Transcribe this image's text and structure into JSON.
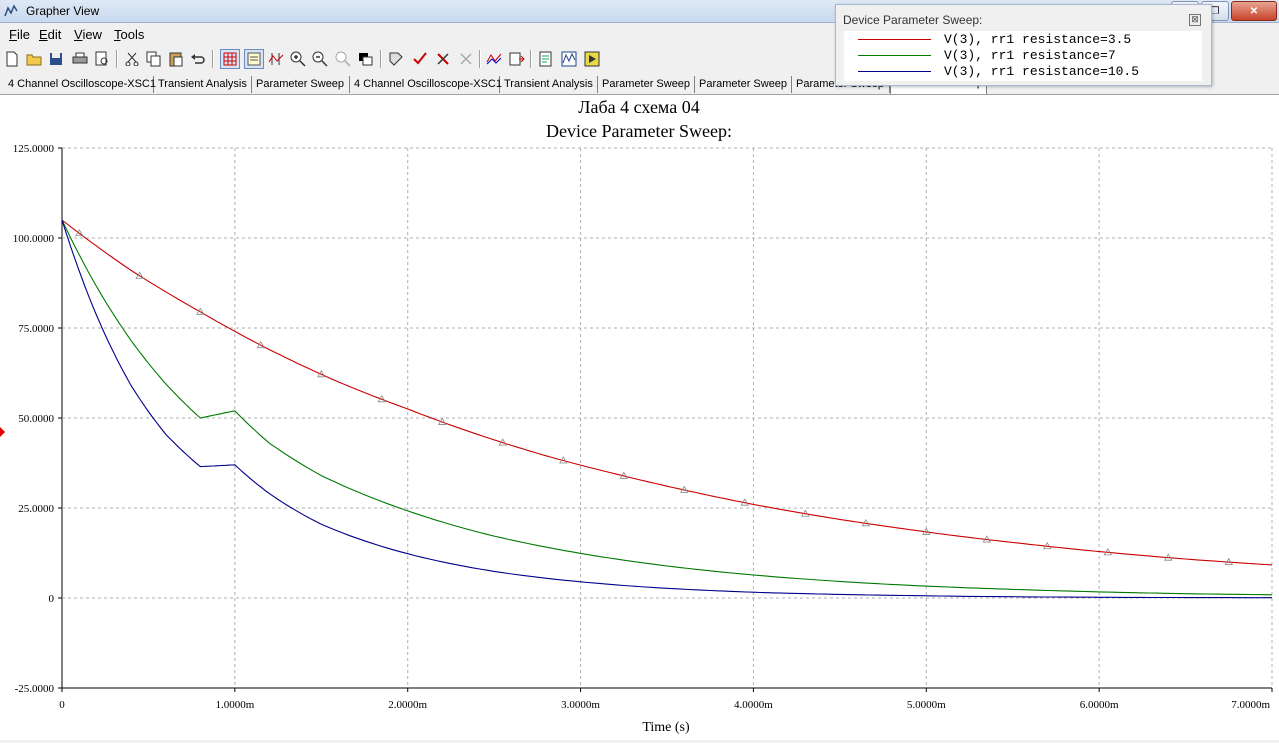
{
  "window": {
    "title": "Grapher View"
  },
  "menu": [
    {
      "label": "File",
      "accel": "F"
    },
    {
      "label": "Edit",
      "accel": "E"
    },
    {
      "label": "View",
      "accel": "V"
    },
    {
      "label": "Tools",
      "accel": "T"
    }
  ],
  "tabs": [
    "4 Channel Oscilloscope-XSC1",
    "Transient Analysis",
    "Parameter Sweep",
    "4 Channel Oscilloscope-XSC1",
    "Transient Analysis",
    "Parameter Sweep",
    "Parameter Sweep",
    "Parameter Sweep",
    "Parameter Sweep"
  ],
  "selected_tab": 8,
  "legend": {
    "title": "Device Parameter Sweep:",
    "items": [
      {
        "label": "V(3), rr1 resistance=3.5",
        "color": "#cc0000"
      },
      {
        "label": "V(3), rr1 resistance=7",
        "color": "#007a00"
      },
      {
        "label": "V(3), rr1 resistance=10.5",
        "color": "#00008b"
      }
    ]
  },
  "chart_data": {
    "type": "line",
    "title": "Лаба 4 схема 04",
    "subtitle": "Device Parameter Sweep:",
    "xlabel": "Time (s)",
    "ylabel": "",
    "xlim": [
      0,
      0.007
    ],
    "ylim": [
      -25,
      125
    ],
    "x_ticks": [
      "0",
      "1.0000m",
      "2.0000m",
      "3.0000m",
      "4.0000m",
      "5.0000m",
      "6.0000m",
      "7.0000m"
    ],
    "y_ticks": [
      "125.0000",
      "100.0000",
      "75.0000",
      "50.0000",
      "25.0000",
      "0",
      "-25.0000"
    ],
    "grid": true,
    "series": [
      {
        "name": "V(3), rr1 resistance=3.5",
        "color": "#cc0000",
        "marker": "triangle",
        "x": [
          0,
          0.0004,
          0.0008,
          0.0012,
          0.0016,
          0.002,
          0.0024,
          0.0028,
          0.0032,
          0.0036,
          0.004,
          0.0044,
          0.0048,
          0.0052,
          0.0056,
          0.006,
          0.0064,
          0.0068,
          0.007
        ],
        "y": [
          105,
          91,
          79.5,
          69,
          60,
          52.5,
          45.5,
          39.5,
          34.5,
          30,
          26,
          22.6,
          19.7,
          17.1,
          14.9,
          12.9,
          11.2,
          9.8,
          9.2
        ]
      },
      {
        "name": "V(3), rr1 resistance=7",
        "color": "#007a00",
        "x": [
          0,
          0.0002,
          0.0004,
          0.0006,
          0.0008,
          0.001,
          0.0012,
          0.0015,
          0.002,
          0.0025,
          0.003,
          0.0035,
          0.004,
          0.0045,
          0.005,
          0.0055,
          0.006,
          0.0065,
          0.007
        ],
        "y": [
          105,
          86.5,
          71.5,
          59.5,
          50,
          52,
          43,
          34,
          24.2,
          17.2,
          12.4,
          8.9,
          6.4,
          4.6,
          3.3,
          2.4,
          1.7,
          1.2,
          0.9
        ]
      },
      {
        "name": "V(3), rr1 resistance=10.5",
        "color": "#00008b",
        "x": [
          0,
          0.0002,
          0.0004,
          0.0006,
          0.0008,
          0.001,
          0.0012,
          0.0015,
          0.002,
          0.0025,
          0.003,
          0.0035,
          0.004,
          0.0045,
          0.005,
          0.0055,
          0.006,
          0.0065,
          0.007
        ],
        "y": [
          105,
          78.5,
          59,
          45.5,
          36.5,
          37,
          29,
          20.5,
          12.3,
          7.4,
          4.5,
          2.7,
          1.6,
          1.0,
          0.6,
          0.35,
          0.2,
          0.12,
          0.08
        ]
      }
    ]
  }
}
